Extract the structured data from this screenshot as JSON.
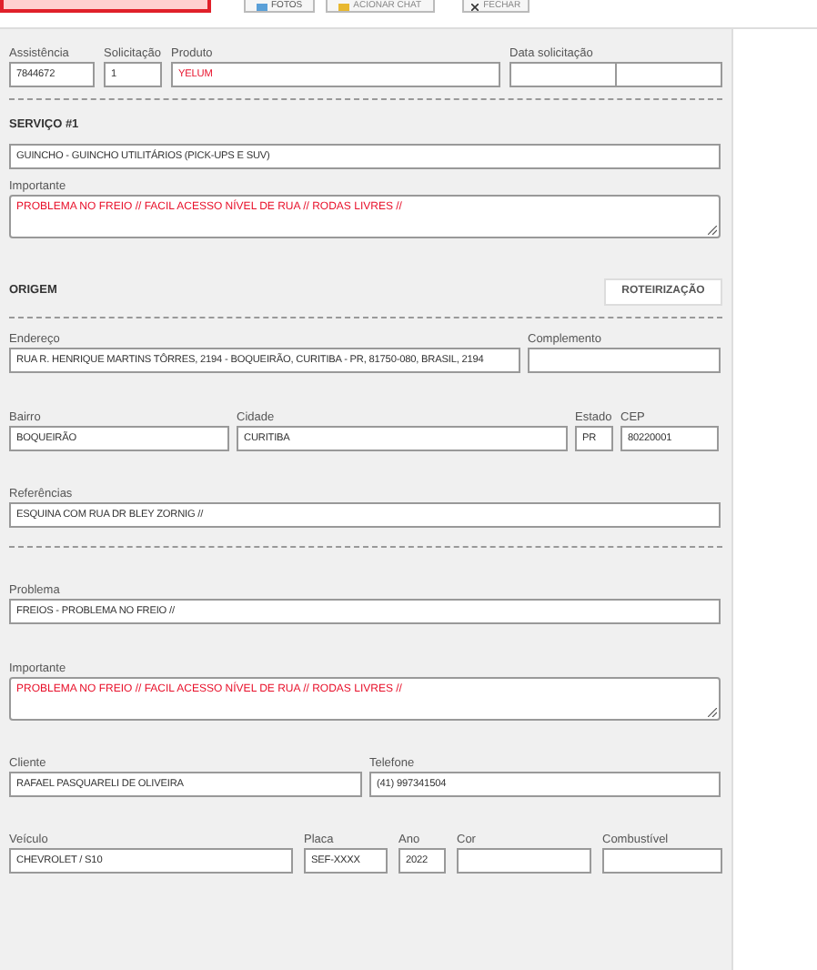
{
  "toolbar": {
    "buttons": [
      {
        "kind": "alert"
      },
      {
        "kind": "photos",
        "label": "FOTOS"
      },
      {
        "kind": "chat",
        "label": "ACIONAR CHAT"
      },
      {
        "kind": "close",
        "label": "FECHAR"
      }
    ]
  },
  "blocks": [
    {
      "kind": "fields",
      "fields": [
        {
          "kind": "input",
          "label": "Assistência",
          "value": "7844672",
          "alert": false
        },
        {
          "kind": "input",
          "label": "Solicitação",
          "value": "1",
          "alert": false
        },
        {
          "kind": "input",
          "label": "Produto",
          "value": "YELUM",
          "alert": true
        },
        {
          "kind": "date-pair",
          "label": "Data solicitação"
        }
      ]
    },
    {
      "kind": "divider"
    },
    {
      "kind": "heading",
      "title": "SERVIÇO #1"
    },
    {
      "kind": "fields",
      "fields": [
        {
          "kind": "input",
          "value": "GUINCHO - GUINCHO UTILITÁRIOS (PICK-UPS E SUV)",
          "alert": false
        }
      ]
    },
    {
      "kind": "fields",
      "fields": [
        {
          "kind": "textarea",
          "label": "Importante",
          "value": "PROBLEMA NO FREIO // FACIL ACESSO NÍVEL DE RUA // RODAS LIVRES //",
          "alert": true
        }
      ]
    },
    {
      "kind": "heading",
      "title": "ORIGEM",
      "action": "ROTEIRIZAÇÃO"
    },
    {
      "kind": "divider"
    },
    {
      "kind": "fields",
      "fields": [
        {
          "kind": "input",
          "label": "Endereço",
          "value": "RUA R. HENRIQUE MARTINS TÔRRES, 2194 - BOQUEIRÃO, CURITIBA - PR, 81750-080, BRASIL, 2194",
          "alert": false
        },
        {
          "kind": "input",
          "label": "Complemento"
        }
      ]
    },
    {
      "kind": "fields",
      "fields": [
        {
          "kind": "input",
          "label": "Bairro",
          "value": "BOQUEIRÃO",
          "alert": false
        },
        {
          "kind": "input",
          "label": "Cidade",
          "value": "CURITIBA",
          "alert": false
        },
        {
          "kind": "input",
          "label": "Estado",
          "value": "PR",
          "alert": false
        },
        {
          "kind": "input",
          "label": "CEP",
          "value": "80220001",
          "alert": false
        }
      ]
    },
    {
      "kind": "fields",
      "fields": [
        {
          "kind": "input",
          "label": "Referências",
          "value": "ESQUINA COM RUA DR BLEY ZORNIG //",
          "alert": false
        }
      ]
    },
    {
      "kind": "divider"
    },
    {
      "kind": "fields",
      "fields": [
        {
          "kind": "input",
          "label": "Problema",
          "value": "FREIOS - PROBLEMA NO FREIO //",
          "alert": false
        }
      ]
    },
    {
      "kind": "fields",
      "fields": [
        {
          "kind": "textarea",
          "label": "Importante",
          "value": "PROBLEMA NO FREIO // FACIL ACESSO NÍVEL DE RUA // RODAS LIVRES //",
          "alert": true
        }
      ]
    },
    {
      "kind": "fields",
      "fields": [
        {
          "kind": "input",
          "label": "Cliente",
          "value": "RAFAEL PASQUARELI DE OLIVEIRA",
          "alert": false
        },
        {
          "kind": "input",
          "label": "Telefone",
          "value": "(41) 997341504",
          "alert": false
        }
      ]
    },
    {
      "kind": "fields",
      "fields": [
        {
          "kind": "input",
          "label": "Veículo",
          "value": "CHEVROLET / S10",
          "alert": false
        },
        {
          "kind": "input",
          "label": "Placa",
          "value": "SEF-XXXX",
          "alert": false
        },
        {
          "kind": "input",
          "label": "Ano",
          "value": "2022",
          "alert": false
        },
        {
          "kind": "input",
          "label": "Cor"
        },
        {
          "kind": "input",
          "label": "Combustível"
        }
      ]
    }
  ]
}
